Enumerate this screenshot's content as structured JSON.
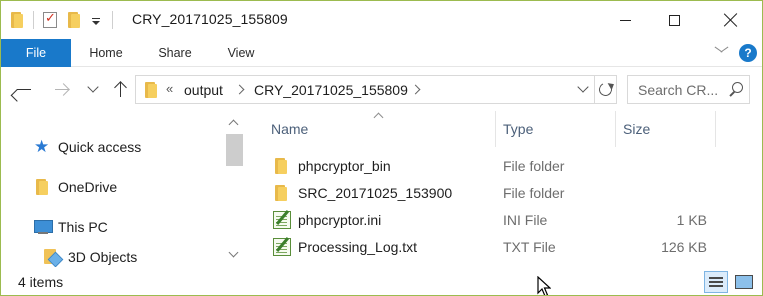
{
  "window": {
    "title": "CRY_20171025_155809",
    "help_label": "?"
  },
  "ribbon": {
    "tabs": [
      {
        "label": "File"
      },
      {
        "label": "Home"
      },
      {
        "label": "Share"
      },
      {
        "label": "View"
      }
    ]
  },
  "address_bar": {
    "overflow": "«",
    "crumbs": [
      "output",
      "CRY_20171025_155809"
    ]
  },
  "search": {
    "placeholder": "Search CR..."
  },
  "navigation": {
    "items": [
      {
        "label": "Quick access",
        "icon": "star-icon"
      },
      {
        "label": "OneDrive",
        "icon": "folder-icon"
      },
      {
        "label": "This PC",
        "icon": "computer-icon"
      },
      {
        "label": "3D Objects",
        "icon": "3d-objects-icon"
      }
    ]
  },
  "file_list": {
    "columns": [
      "Name",
      "Type",
      "Size"
    ],
    "rows": [
      {
        "name": "phpcryptor_bin",
        "type": "File folder",
        "size": "",
        "icon": "folder-icon"
      },
      {
        "name": "SRC_20171025_153900",
        "type": "File folder",
        "size": "",
        "icon": "folder-icon"
      },
      {
        "name": "phpcryptor.ini",
        "type": "INI File",
        "size": "1 KB",
        "icon": "notepad-icon"
      },
      {
        "name": "Processing_Log.txt",
        "type": "TXT File",
        "size": "126 KB",
        "icon": "notepad-icon"
      }
    ]
  },
  "status": {
    "item_count": "4 items"
  },
  "colors": {
    "accent": "#1979ca",
    "window_border": "#9cbb4f",
    "header_text": "#4c607a",
    "secondary_text": "#6d6d6d"
  }
}
